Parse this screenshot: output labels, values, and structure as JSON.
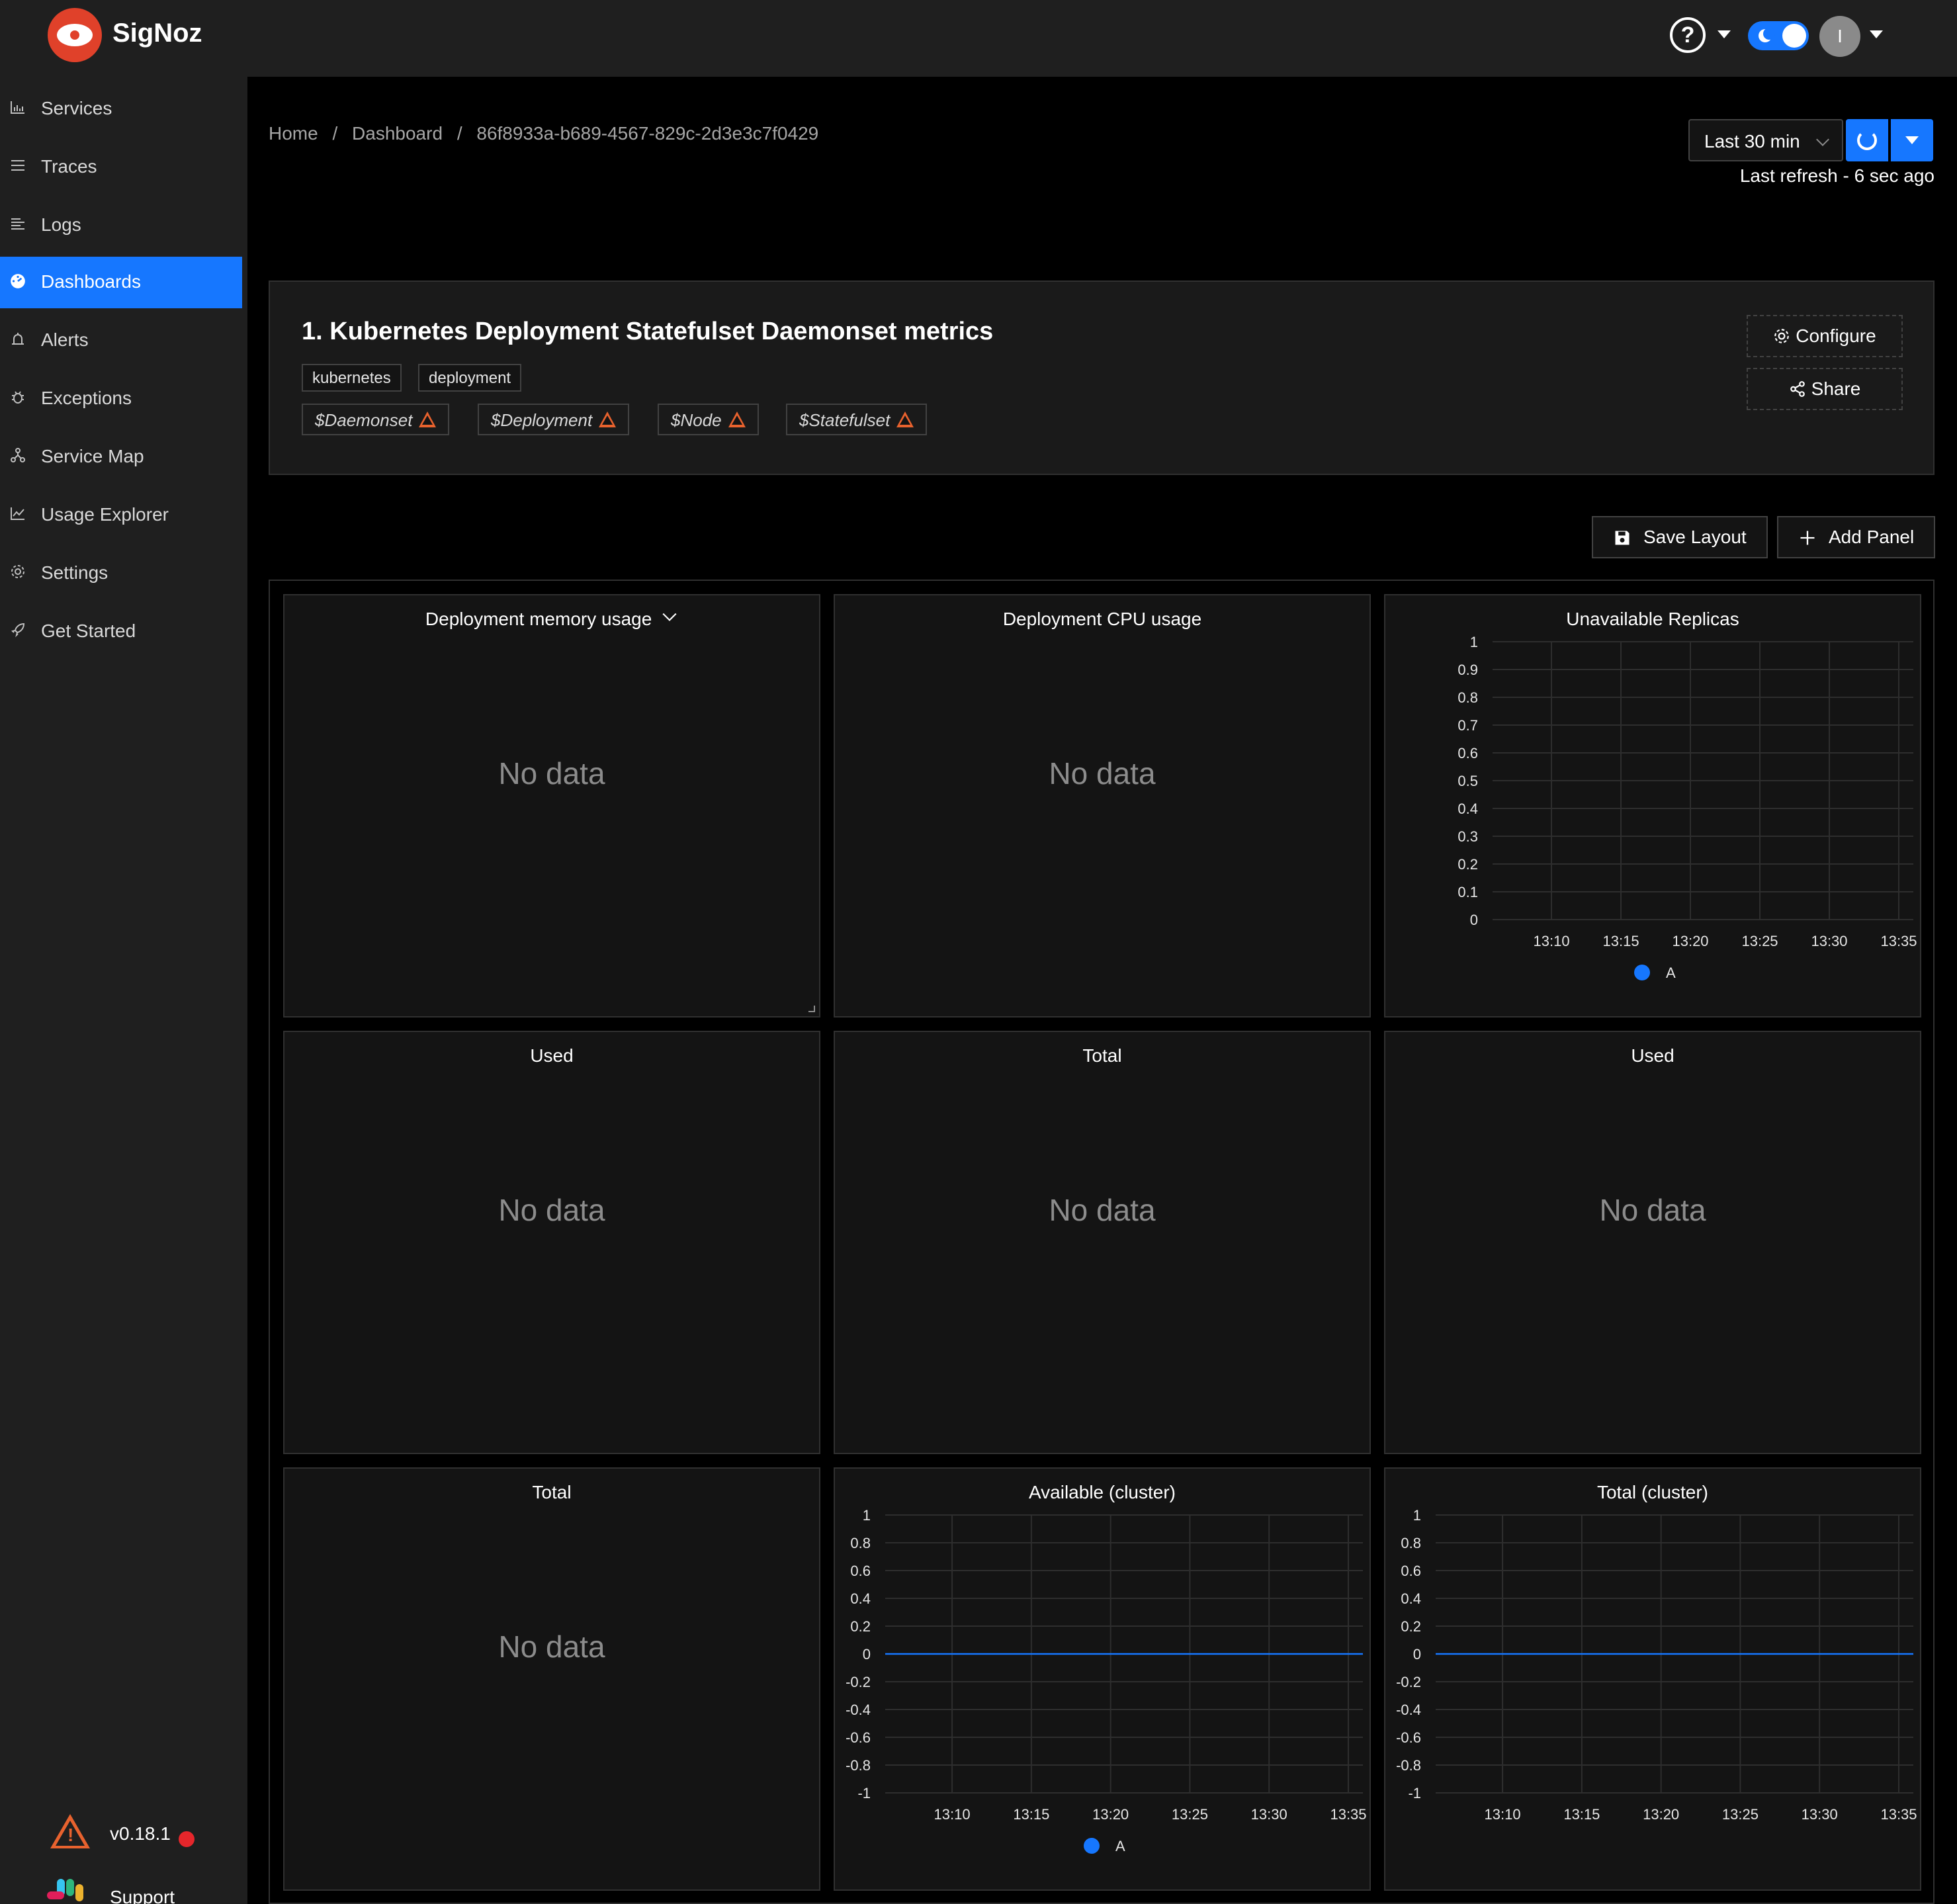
{
  "app": {
    "brand": "SigNoz",
    "help_glyph": "?",
    "avatar_initial": "I"
  },
  "sidebar": {
    "items": [
      {
        "label": "Services",
        "icon": "bar-chart-icon"
      },
      {
        "label": "Traces",
        "icon": "menu-icon"
      },
      {
        "label": "Logs",
        "icon": "align-left-icon"
      },
      {
        "label": "Dashboards",
        "icon": "dashboard-icon",
        "active": true
      },
      {
        "label": "Alerts",
        "icon": "alarm-icon"
      },
      {
        "label": "Exceptions",
        "icon": "bug-icon"
      },
      {
        "label": "Service Map",
        "icon": "deployment-unit-icon"
      },
      {
        "label": "Usage Explorer",
        "icon": "line-chart-icon"
      },
      {
        "label": "Settings",
        "icon": "gear-icon"
      },
      {
        "label": "Get Started",
        "icon": "rocket-icon"
      }
    ],
    "version": "v0.18.1",
    "support": "Support"
  },
  "breadcrumb": [
    "Home",
    "/",
    "Dashboard",
    "/",
    "86f8933a-b689-4567-829c-2d3e3c7f0429"
  ],
  "time": {
    "selected": "Last 30 min",
    "last_refresh": "Last refresh - 6 sec ago"
  },
  "dashboard": {
    "title": "1. Kubernetes Deployment Statefulset Daemonset metrics",
    "tags": [
      "kubernetes",
      "deployment"
    ],
    "variables": [
      "$Daemonset",
      "$Deployment",
      "$Node",
      "$Statefulset"
    ],
    "configure_label": "Configure",
    "share_label": "Share",
    "save_layout_label": "Save Layout",
    "add_panel_label": "Add Panel"
  },
  "panels": [
    {
      "title": "Deployment memory usage",
      "nodata": "No data",
      "has_menu": true
    },
    {
      "title": "Deployment CPU usage",
      "nodata": "No data"
    },
    {
      "title": "Unavailable Replicas",
      "chart": 0
    },
    {
      "title": "Used",
      "nodata": "No data"
    },
    {
      "title": "Total",
      "nodata": "No data"
    },
    {
      "title": "Used",
      "nodata": "No data"
    },
    {
      "title": "Total",
      "nodata": "No data"
    },
    {
      "title": "Available (cluster)",
      "chart": 1
    },
    {
      "title": "Total (cluster)",
      "chart": 2
    }
  ],
  "colors": {
    "accent": "#1677ff",
    "warning": "#e8622e",
    "brand": "#e0412a"
  },
  "chart_data": [
    {
      "type": "line",
      "title": "Unavailable Replicas",
      "yticks": [
        "1",
        "0.9",
        "0.8",
        "0.7",
        "0.6",
        "0.5",
        "0.4",
        "0.3",
        "0.2",
        "0.1",
        "0"
      ],
      "ylim": [
        0,
        1
      ],
      "xticks": [
        "13:10",
        "13:15",
        "13:20",
        "13:25",
        "13:30",
        "13:35"
      ],
      "grid": true,
      "legend": "bottom",
      "series": [
        {
          "name": "A",
          "color": "#1677ff",
          "values": []
        }
      ]
    },
    {
      "type": "line",
      "title": "Available (cluster)",
      "yticks": [
        "1",
        "0.8",
        "0.6",
        "0.4",
        "0.2",
        "0",
        "-0.2",
        "-0.4",
        "-0.6",
        "-0.8",
        "-1"
      ],
      "ylim": [
        -1,
        1
      ],
      "xticks": [
        "13:10",
        "13:15",
        "13:20",
        "13:25",
        "13:30",
        "13:35"
      ],
      "grid": true,
      "legend": "bottom",
      "series": [
        {
          "name": "A",
          "color": "#1677ff",
          "values": [
            0,
            0,
            0,
            0,
            0,
            0,
            0
          ]
        }
      ]
    },
    {
      "type": "line",
      "title": "Total (cluster)",
      "yticks": [
        "1",
        "0.8",
        "0.6",
        "0.4",
        "0.2",
        "0",
        "-0.2",
        "-0.4",
        "-0.6",
        "-0.8",
        "-1"
      ],
      "ylim": [
        -1,
        1
      ],
      "xticks": [
        "13:10",
        "13:15",
        "13:20",
        "13:25",
        "13:30",
        "13:35"
      ],
      "grid": true,
      "legend": "none",
      "series": [
        {
          "color": "#1677ff",
          "values": [
            0,
            0,
            0,
            0,
            0,
            0,
            0
          ]
        }
      ]
    }
  ]
}
